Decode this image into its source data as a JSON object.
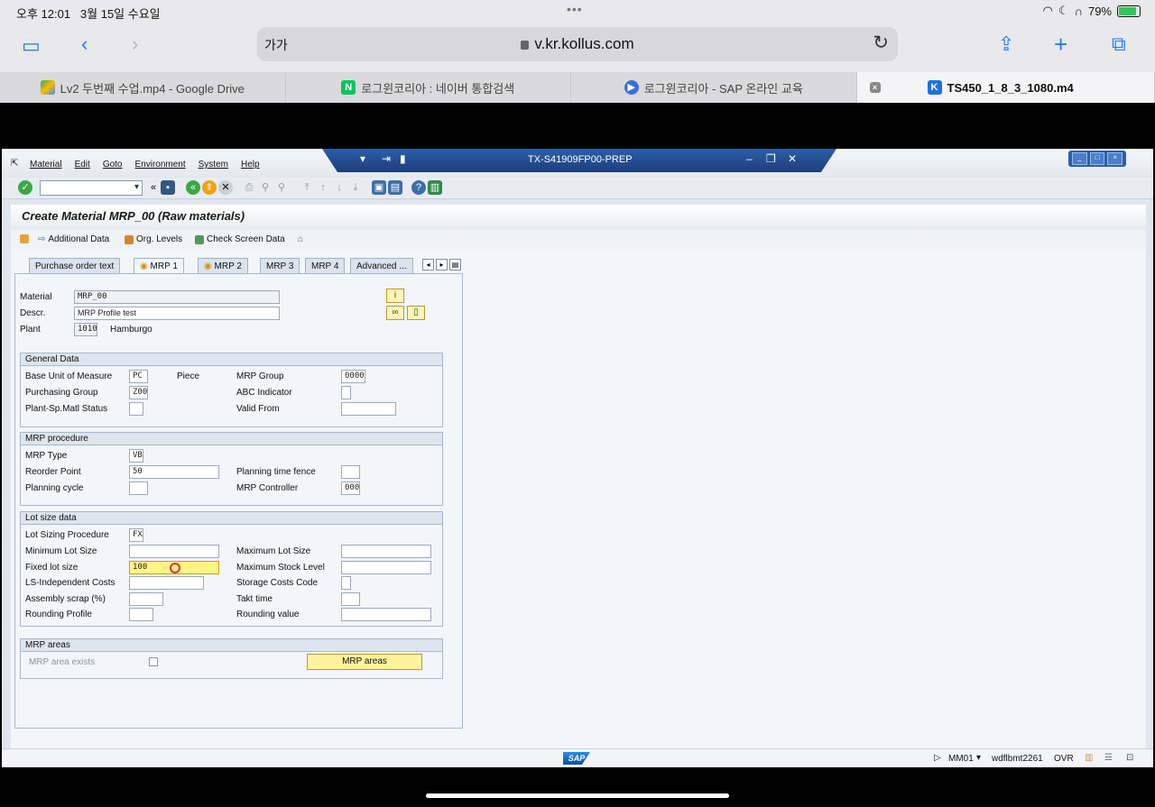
{
  "ios": {
    "time": "오후 12:01",
    "date": "3월 15일 수요일",
    "battery": "79%"
  },
  "safari": {
    "aa": "가가",
    "url": "v.kr.kollus.com",
    "tabs": [
      {
        "label": "Lv2 두번째 수업.mp4 - Google Drive"
      },
      {
        "label": "로그윈코리아 : 네이버 통합검색"
      },
      {
        "label": "로그윈코리아 - SAP 온라인 교육"
      },
      {
        "label": "TS450_1_8_3_1080.m4"
      }
    ]
  },
  "sap": {
    "menus": [
      "Material",
      "Edit",
      "Goto",
      "Environment",
      "System",
      "Help"
    ],
    "window_title": "TX-S41909FP00-PREP",
    "screen_title": "Create Material MRP_00 (Raw materials)",
    "app_toolbar": {
      "additional_data": "Additional Data",
      "org_levels": "Org. Levels",
      "check_screen_data": "Check Screen Data"
    },
    "tabs": [
      "Purchase order text",
      "MRP 1",
      "MRP 2",
      "MRP 3",
      "MRP 4",
      "Advanced ..."
    ],
    "header": {
      "material_label": "Material",
      "material_value": "MRP_00",
      "descr_label": "Descr.",
      "descr_value": "MRP Profile test",
      "plant_label": "Plant",
      "plant_value": "1010",
      "plant_name": "Hamburgo"
    },
    "general": {
      "title": "General Data",
      "base_uom_label": "Base Unit of Measure",
      "base_uom_value": "PC",
      "base_uom_text": "Piece",
      "mrp_group_label": "MRP Group",
      "mrp_group_value": "0000",
      "purch_group_label": "Purchasing Group",
      "purch_group_value": "Z00",
      "abc_label": "ABC Indicator",
      "plant_status_label": "Plant-Sp.Matl Status",
      "valid_from_label": "Valid From"
    },
    "procedure": {
      "title": "MRP procedure",
      "mrp_type_label": "MRP Type",
      "mrp_type_value": "VB",
      "reorder_label": "Reorder Point",
      "reorder_value": "50",
      "fence_label": "Planning time fence",
      "cycle_label": "Planning cycle",
      "controller_label": "MRP Controller",
      "controller_value": "000"
    },
    "lotsize": {
      "title": "Lot size data",
      "procedure_label": "Lot Sizing Procedure",
      "procedure_value": "FX",
      "min_label": "Minimum Lot Size",
      "max_label": "Maximum Lot Size",
      "fixed_label": "Fixed lot size",
      "fixed_value": "100",
      "max_stock_label": "Maximum Stock Level",
      "ls_costs_label": "LS-Independent Costs",
      "storage_costs_label": "Storage Costs Code",
      "scrap_label": "Assembly scrap (%)",
      "takt_label": "Takt time",
      "rounding_profile_label": "Rounding Profile",
      "rounding_value_label": "Rounding value"
    },
    "areas": {
      "title": "MRP areas",
      "exists_label": "MRP area exists",
      "button": "MRP areas"
    },
    "status": {
      "tcode": "MM01",
      "server": "wdflbmt2261",
      "mode": "OVR"
    }
  }
}
